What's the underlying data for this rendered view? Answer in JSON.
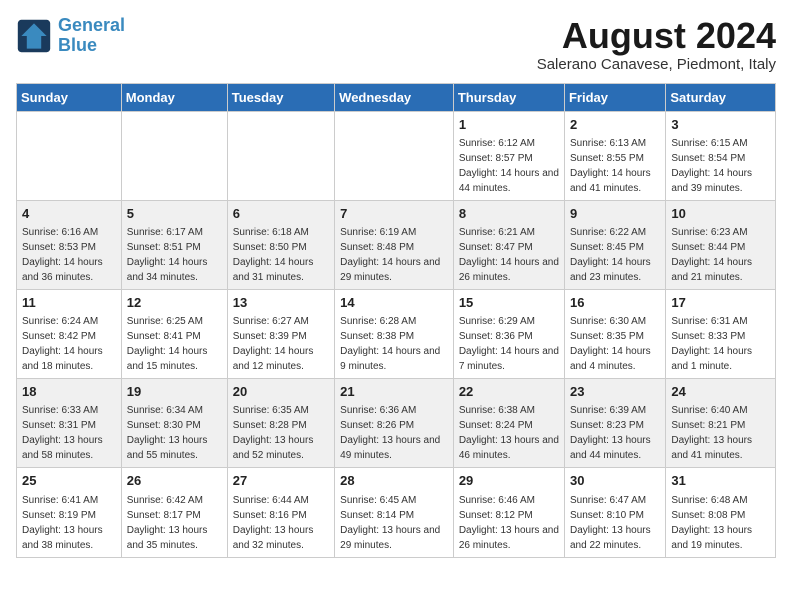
{
  "logo": {
    "line1": "General",
    "line2": "Blue"
  },
  "title": "August 2024",
  "subtitle": "Salerano Canavese, Piedmont, Italy",
  "days_of_week": [
    "Sunday",
    "Monday",
    "Tuesday",
    "Wednesday",
    "Thursday",
    "Friday",
    "Saturday"
  ],
  "weeks": [
    [
      {
        "day": "",
        "info": ""
      },
      {
        "day": "",
        "info": ""
      },
      {
        "day": "",
        "info": ""
      },
      {
        "day": "",
        "info": ""
      },
      {
        "day": "1",
        "info": "Sunrise: 6:12 AM\nSunset: 8:57 PM\nDaylight: 14 hours and 44 minutes."
      },
      {
        "day": "2",
        "info": "Sunrise: 6:13 AM\nSunset: 8:55 PM\nDaylight: 14 hours and 41 minutes."
      },
      {
        "day": "3",
        "info": "Sunrise: 6:15 AM\nSunset: 8:54 PM\nDaylight: 14 hours and 39 minutes."
      }
    ],
    [
      {
        "day": "4",
        "info": "Sunrise: 6:16 AM\nSunset: 8:53 PM\nDaylight: 14 hours and 36 minutes."
      },
      {
        "day": "5",
        "info": "Sunrise: 6:17 AM\nSunset: 8:51 PM\nDaylight: 14 hours and 34 minutes."
      },
      {
        "day": "6",
        "info": "Sunrise: 6:18 AM\nSunset: 8:50 PM\nDaylight: 14 hours and 31 minutes."
      },
      {
        "day": "7",
        "info": "Sunrise: 6:19 AM\nSunset: 8:48 PM\nDaylight: 14 hours and 29 minutes."
      },
      {
        "day": "8",
        "info": "Sunrise: 6:21 AM\nSunset: 8:47 PM\nDaylight: 14 hours and 26 minutes."
      },
      {
        "day": "9",
        "info": "Sunrise: 6:22 AM\nSunset: 8:45 PM\nDaylight: 14 hours and 23 minutes."
      },
      {
        "day": "10",
        "info": "Sunrise: 6:23 AM\nSunset: 8:44 PM\nDaylight: 14 hours and 21 minutes."
      }
    ],
    [
      {
        "day": "11",
        "info": "Sunrise: 6:24 AM\nSunset: 8:42 PM\nDaylight: 14 hours and 18 minutes."
      },
      {
        "day": "12",
        "info": "Sunrise: 6:25 AM\nSunset: 8:41 PM\nDaylight: 14 hours and 15 minutes."
      },
      {
        "day": "13",
        "info": "Sunrise: 6:27 AM\nSunset: 8:39 PM\nDaylight: 14 hours and 12 minutes."
      },
      {
        "day": "14",
        "info": "Sunrise: 6:28 AM\nSunset: 8:38 PM\nDaylight: 14 hours and 9 minutes."
      },
      {
        "day": "15",
        "info": "Sunrise: 6:29 AM\nSunset: 8:36 PM\nDaylight: 14 hours and 7 minutes."
      },
      {
        "day": "16",
        "info": "Sunrise: 6:30 AM\nSunset: 8:35 PM\nDaylight: 14 hours and 4 minutes."
      },
      {
        "day": "17",
        "info": "Sunrise: 6:31 AM\nSunset: 8:33 PM\nDaylight: 14 hours and 1 minute."
      }
    ],
    [
      {
        "day": "18",
        "info": "Sunrise: 6:33 AM\nSunset: 8:31 PM\nDaylight: 13 hours and 58 minutes."
      },
      {
        "day": "19",
        "info": "Sunrise: 6:34 AM\nSunset: 8:30 PM\nDaylight: 13 hours and 55 minutes."
      },
      {
        "day": "20",
        "info": "Sunrise: 6:35 AM\nSunset: 8:28 PM\nDaylight: 13 hours and 52 minutes."
      },
      {
        "day": "21",
        "info": "Sunrise: 6:36 AM\nSunset: 8:26 PM\nDaylight: 13 hours and 49 minutes."
      },
      {
        "day": "22",
        "info": "Sunrise: 6:38 AM\nSunset: 8:24 PM\nDaylight: 13 hours and 46 minutes."
      },
      {
        "day": "23",
        "info": "Sunrise: 6:39 AM\nSunset: 8:23 PM\nDaylight: 13 hours and 44 minutes."
      },
      {
        "day": "24",
        "info": "Sunrise: 6:40 AM\nSunset: 8:21 PM\nDaylight: 13 hours and 41 minutes."
      }
    ],
    [
      {
        "day": "25",
        "info": "Sunrise: 6:41 AM\nSunset: 8:19 PM\nDaylight: 13 hours and 38 minutes."
      },
      {
        "day": "26",
        "info": "Sunrise: 6:42 AM\nSunset: 8:17 PM\nDaylight: 13 hours and 35 minutes."
      },
      {
        "day": "27",
        "info": "Sunrise: 6:44 AM\nSunset: 8:16 PM\nDaylight: 13 hours and 32 minutes."
      },
      {
        "day": "28",
        "info": "Sunrise: 6:45 AM\nSunset: 8:14 PM\nDaylight: 13 hours and 29 minutes."
      },
      {
        "day": "29",
        "info": "Sunrise: 6:46 AM\nSunset: 8:12 PM\nDaylight: 13 hours and 26 minutes."
      },
      {
        "day": "30",
        "info": "Sunrise: 6:47 AM\nSunset: 8:10 PM\nDaylight: 13 hours and 22 minutes."
      },
      {
        "day": "31",
        "info": "Sunrise: 6:48 AM\nSunset: 8:08 PM\nDaylight: 13 hours and 19 minutes."
      }
    ]
  ]
}
